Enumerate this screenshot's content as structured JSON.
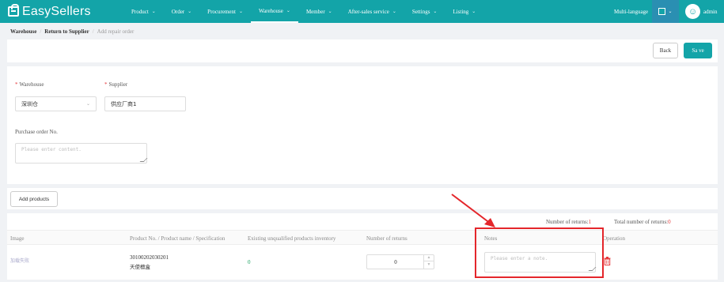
{
  "brand": {
    "name": "EasySellers"
  },
  "nav": {
    "items": [
      {
        "label": "Product"
      },
      {
        "label": "Order"
      },
      {
        "label": "Procurement"
      },
      {
        "label": "Warehouse",
        "active": true
      },
      {
        "label": "Member"
      },
      {
        "label": "After-sales service"
      },
      {
        "label": "Settings"
      },
      {
        "label": "Listing"
      }
    ],
    "multi_language": "Multi-language",
    "user": "admin",
    "theme_color": "#13a4a8"
  },
  "breadcrumb": [
    "Warehouse",
    "Return to Supplier",
    "Add repair order"
  ],
  "toolbar": {
    "back_label": "Back",
    "save_label": "Sa ve"
  },
  "form": {
    "warehouse_label": "Warehouse",
    "warehouse_value": "深圳仓",
    "supplier_label": "Supplier",
    "supplier_value": "供应厂商1",
    "po_label": "Purchase order No.",
    "po_placeholder": "Please enter content."
  },
  "add_products_label": "Add products",
  "summary": {
    "returns_label": "Number of returns:",
    "returns_value": "1",
    "total_label": "Total number of returns:",
    "total_value": "0"
  },
  "table": {
    "columns": [
      "Image",
      "Product No. / Product name / Specification",
      "Existing unqualified products inventory",
      "Number of returns",
      "Notes",
      "Operation"
    ],
    "rows": [
      {
        "image": "加载失败",
        "product_no": "30100202030201",
        "product_name": "天使檀盒",
        "inventory": "0",
        "returns": "0",
        "notes_placeholder": "Please enter a note."
      }
    ]
  },
  "colors": {
    "accent": "#13a4a8",
    "danger": "#e4393c",
    "annotation": "#e4262b"
  }
}
